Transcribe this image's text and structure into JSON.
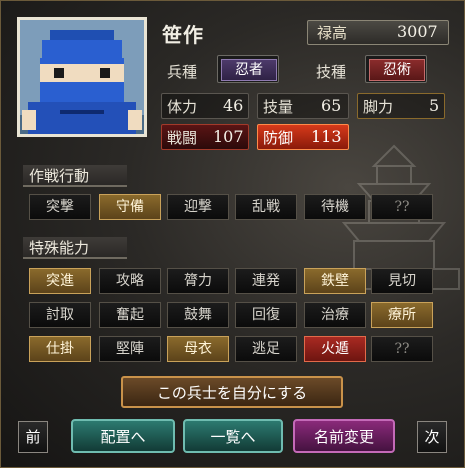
{
  "unit": {
    "name": "笹作",
    "salary_label": "禄高",
    "salary_value": "3007",
    "type_label": "兵種",
    "type_value": "忍者",
    "skill_label": "技種",
    "skill_value": "忍術",
    "stats": {
      "hp_label": "体力",
      "hp": "46",
      "skill_amount_label": "技量",
      "skill_amount": "65",
      "leg_label": "脚力",
      "leg": "5",
      "attack_label": "戦闘",
      "attack": "107",
      "defense_label": "防御",
      "defense": "113"
    }
  },
  "tactics": {
    "title": "作戦行動",
    "buttons": [
      {
        "label": "突撃",
        "state": "normal"
      },
      {
        "label": "守備",
        "state": "on"
      },
      {
        "label": "迎撃",
        "state": "normal"
      },
      {
        "label": "乱戦",
        "state": "normal"
      },
      {
        "label": "待機",
        "state": "normal"
      },
      {
        "label": "??",
        "state": "grey"
      }
    ]
  },
  "abilities": {
    "title": "特殊能力",
    "buttons": [
      {
        "label": "突進",
        "state": "on"
      },
      {
        "label": "攻略",
        "state": "normal"
      },
      {
        "label": "膂力",
        "state": "normal"
      },
      {
        "label": "連発",
        "state": "normal"
      },
      {
        "label": "鉄壁",
        "state": "on"
      },
      {
        "label": "見切",
        "state": "normal"
      },
      {
        "label": "討取",
        "state": "normal"
      },
      {
        "label": "奮起",
        "state": "normal"
      },
      {
        "label": "鼓舞",
        "state": "normal"
      },
      {
        "label": "回復",
        "state": "normal"
      },
      {
        "label": "治療",
        "state": "normal"
      },
      {
        "label": "療所",
        "state": "on"
      },
      {
        "label": "仕掛",
        "state": "on"
      },
      {
        "label": "堅陣",
        "state": "normal"
      },
      {
        "label": "母衣",
        "state": "on"
      },
      {
        "label": "逃足",
        "state": "normal"
      },
      {
        "label": "火遁",
        "state": "red"
      },
      {
        "label": "??",
        "state": "grey"
      }
    ]
  },
  "actions": {
    "self_label": "この兵士を自分にする",
    "prev_label": "前",
    "deploy_label": "配置へ",
    "list_label": "一覧へ",
    "rename_label": "名前変更",
    "next_label": "次"
  },
  "colors": {
    "gold": "#8a6a2c",
    "red": "#a92a22",
    "teal": "#1f5a54",
    "purple": "#6a1f5c"
  }
}
